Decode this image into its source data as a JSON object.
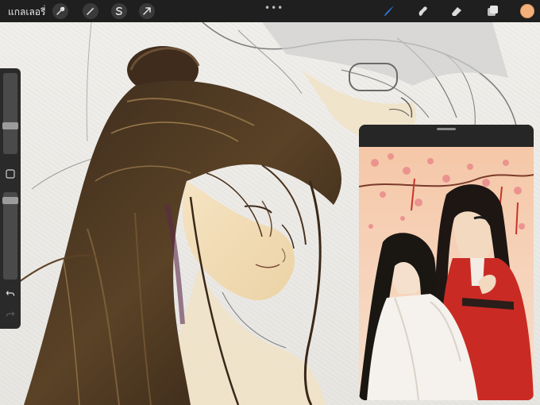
{
  "topbar": {
    "gallery_label": "แกลเลอรี่",
    "left_tools": [
      "wrench-icon",
      "magic-wand-icon",
      "selection-icon",
      "transform-arrow-icon"
    ],
    "more_icon": "more-dots-icon",
    "right_tools": [
      "brush-icon",
      "smudge-icon",
      "eraser-icon",
      "layers-icon"
    ],
    "color_value": "#f3b07a",
    "accent": "#2f7de1"
  },
  "sidebar": {
    "brush_size_slider": "slider",
    "modifier_button": "square-icon",
    "opacity_slider": "slider",
    "undo_icon": "undo-icon",
    "redo_icon": "redo-icon"
  },
  "reference": {
    "handle_icon": "drag-handle-icon",
    "image": "reference-artwork"
  }
}
